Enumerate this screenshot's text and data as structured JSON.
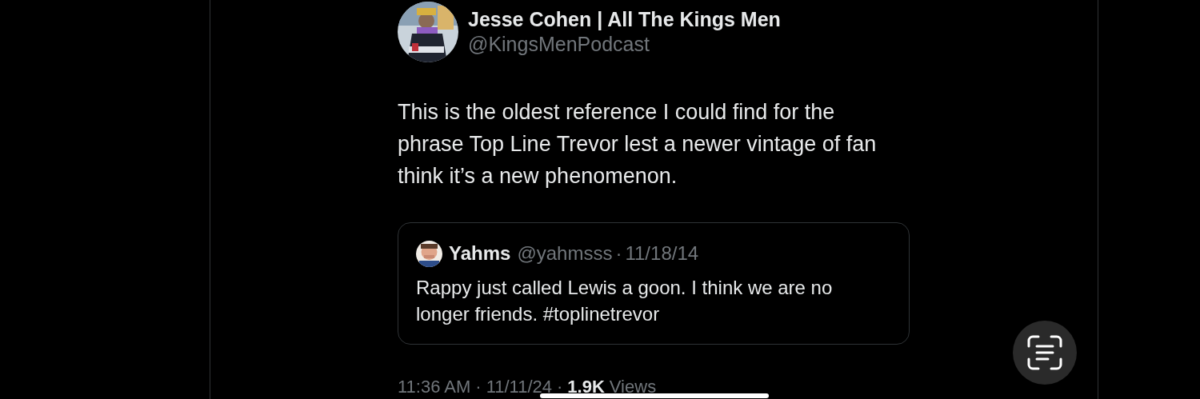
{
  "post": {
    "author_name": "Jesse Cohen | All The Kings Men",
    "author_handle": "@KingsMenPodcast",
    "text": "This is the oldest reference I could find for the phrase Top Line Trevor lest a newer vintage of fan think it’s a new phenomenon.",
    "quoted_post": {
      "author_name": "Yahms",
      "author_handle": "@yahmsss",
      "separator": "·",
      "date": "11/18/14",
      "text": "Rappy just called Lewis a goon. I think we are no longer friends. #toplinetrevor"
    },
    "time": "11:36 AM",
    "date": "11/11/24",
    "views_count": "1.9K",
    "views_label": "Views"
  }
}
